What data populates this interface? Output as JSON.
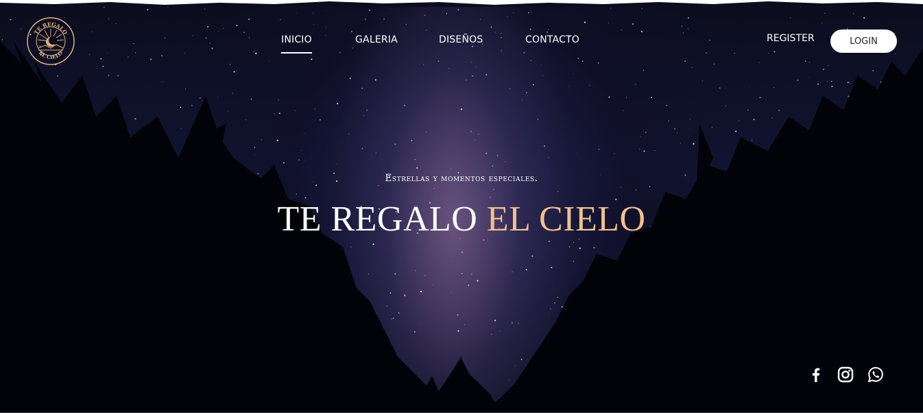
{
  "logo": {
    "top_text": "TE REGALO",
    "bottom_text": "EL CIELO",
    "icon": "sun-moon-emblem-icon",
    "color": "#e0b27c"
  },
  "nav": {
    "items": [
      {
        "label": "INICIO",
        "active": true
      },
      {
        "label": "GALERIA",
        "active": false
      },
      {
        "label": "DISEÑOS",
        "active": false
      },
      {
        "label": "CONTACTO",
        "active": false
      }
    ],
    "register_label": "REGISTER",
    "login_label": "LOGIN"
  },
  "hero": {
    "subtitle": "Estrellas y momentos especiales.",
    "title_white": "TE REGALO",
    "title_gold": "EL CIELO",
    "gold_color": "#f2c08e"
  },
  "socials": [
    {
      "icon": "facebook-icon"
    },
    {
      "icon": "instagram-icon"
    },
    {
      "icon": "whatsapp-icon"
    }
  ]
}
